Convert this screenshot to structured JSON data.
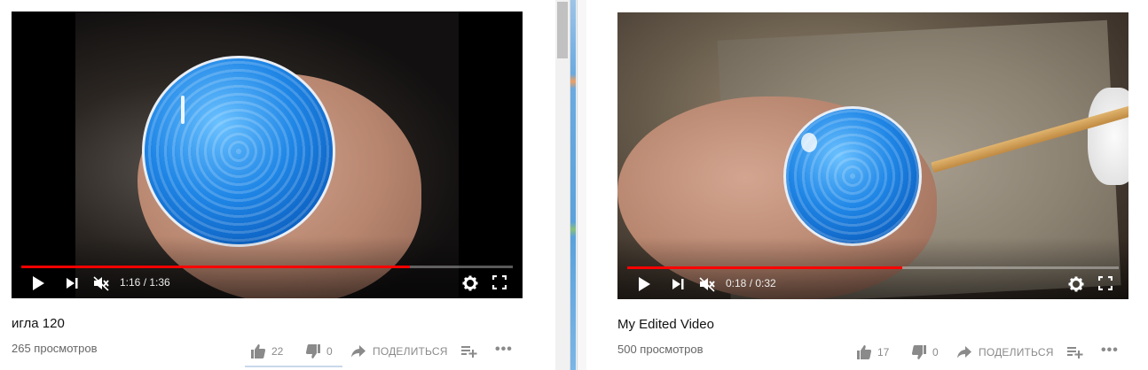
{
  "videos": [
    {
      "title": "игла 120",
      "views": "265 просмотров",
      "time": "1:16 / 1:36",
      "progress": 0.79,
      "likes": "22",
      "dislikes": "0",
      "share_label": "ПОДЕЛИТЬСЯ"
    },
    {
      "title": "My Edited Video",
      "views": "500 просмотров",
      "time": "0:18 / 0:32",
      "progress": 0.56,
      "likes": "17",
      "dislikes": "0",
      "share_label": "ПОДЕЛИТЬСЯ"
    }
  ],
  "icons": {
    "play": "play-icon",
    "next": "next-icon",
    "mute": "volume-muted-icon",
    "settings": "gear-icon",
    "fullscreen": "fullscreen-icon",
    "like": "thumbs-up-icon",
    "dislike": "thumbs-down-icon",
    "share": "share-arrow-icon",
    "add_to": "add-to-playlist-icon",
    "more": "more-horizontal-icon"
  },
  "colors": {
    "progress": "#ff0000",
    "enamel": "#1f86e6",
    "action_grey": "#8a8a8a"
  },
  "more_glyph": "•••"
}
